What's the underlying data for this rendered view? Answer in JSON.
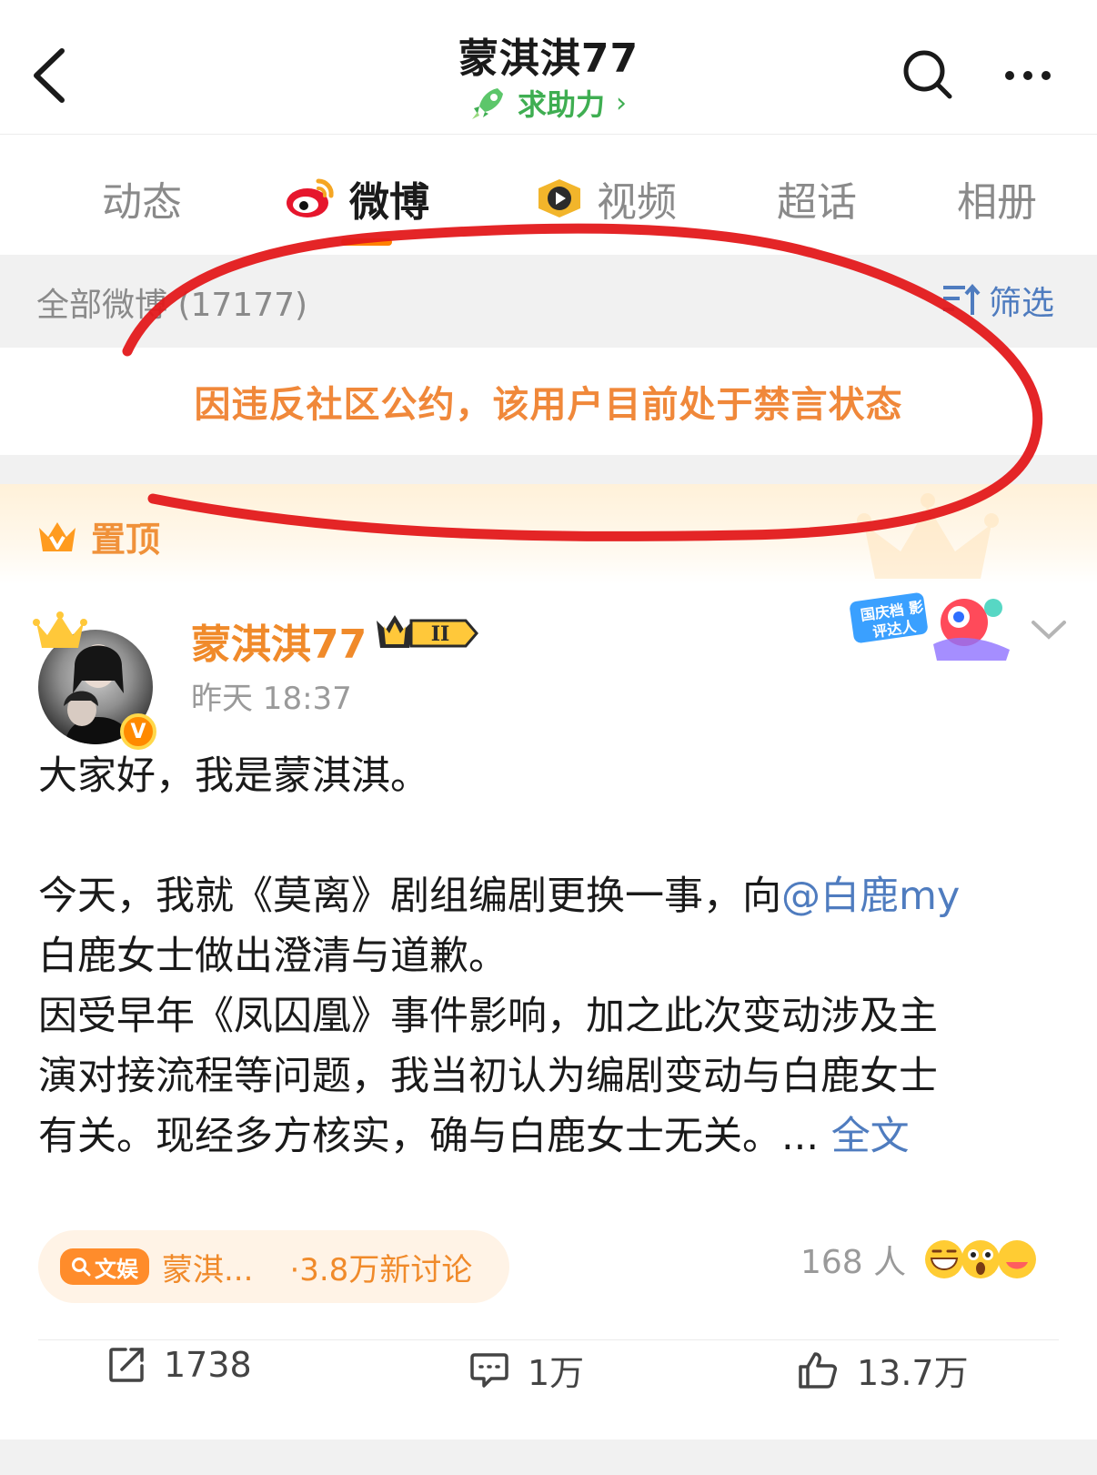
{
  "header": {
    "title": "蒙淇淇77",
    "helper_label": "求助力",
    "helper_arrow": "›"
  },
  "tabs": [
    {
      "label": "动态",
      "active": false
    },
    {
      "label": "微博",
      "active": true,
      "icon": "weibo-logo-icon"
    },
    {
      "label": "视频",
      "active": false,
      "icon": "video-play-icon"
    },
    {
      "label": "超话",
      "active": false
    },
    {
      "label": "相册",
      "active": false
    }
  ],
  "filter_bar": {
    "all_posts": "全部微博 (17177)",
    "filter_label": "筛选"
  },
  "ban_notice": "因违反社区公约，该用户目前处于禁言状态",
  "pinned": {
    "label": "置顶"
  },
  "post": {
    "author": "蒙淇淇77",
    "vip_level": "II",
    "timestamp": "昨天 18:37",
    "verified_mark": "V",
    "event_badge_text": "国庆档 影评达人",
    "body": {
      "line1": "大家好，我是蒙淇淇。",
      "line2_pre": "今天，我就《莫离》剧组编剧更换一事，向",
      "mention": "@白鹿my",
      "line3": "白鹿女士做出澄清与道歉。",
      "line4": "因受早年《凤囚凰》事件影响，加之此次变动涉及主",
      "line5": "演对接流程等问题，我当初认为编剧变动与白鹿女士",
      "line6_pre": "有关。现经多方核实，确与白鹿女士无关。... ",
      "read_more": "全文"
    },
    "topic": {
      "tag_icon": "search-icon",
      "tag_label": "文娱",
      "name": "蒙淇...",
      "discussion": "·3.8万新讨论"
    },
    "reactions": {
      "count": "168 人"
    },
    "actions": {
      "repost": "1738",
      "comment": "1万",
      "like": "13.7万"
    }
  },
  "colors": {
    "accent_orange": "#ff8200",
    "link_blue": "#4f7cbf",
    "helper_green": "#3fae52",
    "annotation_red": "#e3191b"
  }
}
